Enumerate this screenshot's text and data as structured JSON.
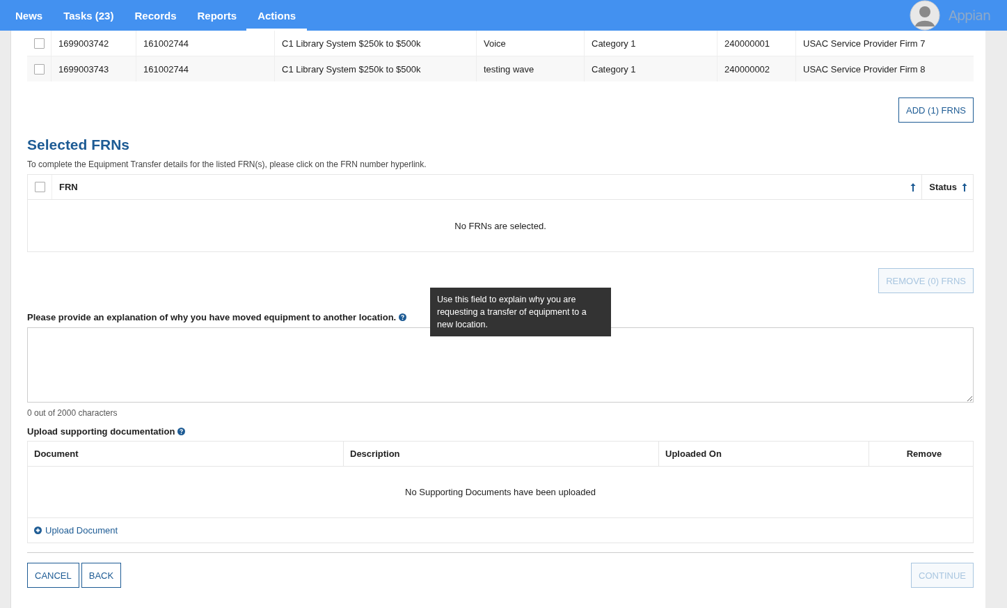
{
  "nav": {
    "tabs": [
      {
        "label": "News",
        "selected": false
      },
      {
        "label": "Tasks (23)",
        "selected": false
      },
      {
        "label": "Records",
        "selected": false
      },
      {
        "label": "Reports",
        "selected": false
      },
      {
        "label": "Actions",
        "selected": true
      }
    ],
    "logo": "Appian"
  },
  "frn_rows": [
    {
      "checked": false,
      "cells": [
        "1699003742",
        "161002744",
        "C1 Library System $250k to $500k",
        "Voice",
        "Category 1",
        "240000001",
        "USAC Service Provider Firm 7"
      ]
    },
    {
      "checked": false,
      "cells": [
        "1699003743",
        "161002744",
        "C1 Library System $250k to $500k",
        "testing wave",
        "Category 1",
        "240000002",
        "USAC Service Provider Firm 8"
      ]
    }
  ],
  "add_button": {
    "label": "ADD (1) FRNS",
    "disabled": false
  },
  "selected_frns": {
    "title": "Selected FRNs",
    "description": "To complete the Equipment Transfer details for the listed FRN(s), please click on the FRN number hyperlink.",
    "select_all_checked": false,
    "columns": [
      "FRN",
      "Status"
    ],
    "empty_message": "No FRNs are selected."
  },
  "remove_button": {
    "label": "REMOVE (0) FRNS",
    "disabled": true
  },
  "explanation": {
    "label": "Please provide an explanation of why you have moved equipment to another location.",
    "tooltip": "Use this field to explain why you are requesting a transfer of equipment to a new location.",
    "counter": "0 out of 2000 characters"
  },
  "upload": {
    "label": "Upload supporting documentation",
    "columns": [
      "Document",
      "Description",
      "Uploaded On",
      "Remove"
    ],
    "empty_message": "No Supporting Documents have been uploaded",
    "link": "Upload Document"
  },
  "footer": {
    "left": [
      {
        "label": "CANCEL",
        "disabled": false
      },
      {
        "label": "BACK",
        "disabled": false
      }
    ],
    "right": [
      {
        "label": "CONTINUE",
        "disabled": true
      }
    ]
  }
}
